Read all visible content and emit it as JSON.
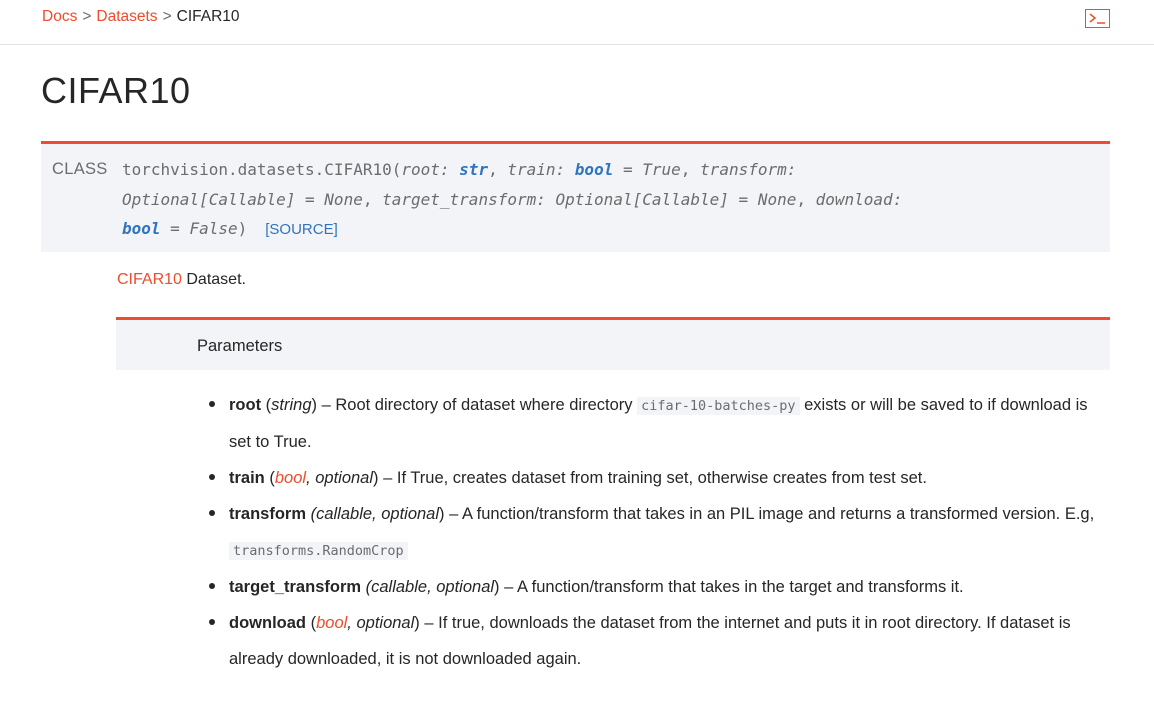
{
  "breadcrumb": {
    "docs": "Docs",
    "sep1": ">",
    "datasets": "Datasets",
    "sep2": ">",
    "current": "CIFAR10"
  },
  "toolbar": {
    "terminal_icon": "terminal-icon"
  },
  "page_title": "CIFAR10",
  "signature": {
    "class_label": "CLASS",
    "prefix": "torchvision.datasets.CIFAR10(",
    "root_name": "root:",
    "root_type": "str",
    "comma1": ",",
    "train_name": "train:",
    "train_type": "bool",
    "train_default": "= True",
    "comma2": ",",
    "transform_name": "transform:",
    "transform_type": "Optional[Callable]",
    "transform_default": "= None",
    "comma3": ",",
    "target_name": "target_transform:",
    "target_type": "Optional[Callable]",
    "target_default": "= None",
    "comma4": ",",
    "download_name": "download:",
    "download_type": "bool",
    "download_default": "= False",
    "close": ")",
    "source_link": "[SOURCE]"
  },
  "description": {
    "name": "CIFAR10",
    "text": " Dataset."
  },
  "parameters": {
    "header": "Parameters",
    "root": {
      "name": "root",
      "open": " (",
      "type": "string",
      "close": ") – ",
      "text1": "Root directory of dataset where directory ",
      "code": "cifar-10-batches-py",
      "text2": " exists or will be saved to if download is set to True."
    },
    "train": {
      "name": "train",
      "open": " (",
      "type": "bool",
      "optional": ", optional",
      "close": ") – ",
      "text": "If True, creates dataset from training set, otherwise creates from test set."
    },
    "transform": {
      "name": "transform",
      "type": " (callable, optional",
      "close": ") – ",
      "text": "A function/transform that takes in an PIL image and returns a transformed version. E.g, ",
      "code": "transforms.RandomCrop"
    },
    "target_transform": {
      "name": "target_transform",
      "type": " (callable, optional",
      "close": ") – ",
      "text": "A function/transform that takes in the target and transforms it."
    },
    "download": {
      "name": "download",
      "open": " (",
      "type": "bool",
      "optional": ", optional",
      "close": ") – ",
      "text": "If true, downloads the dataset from the internet and puts it in root directory. If dataset is already downloaded, it is not downloaded again."
    }
  },
  "colors": {
    "accent": "#ee4c2c",
    "type_blue": "#2f74c0",
    "signature_bg": "#f3f4f7"
  }
}
